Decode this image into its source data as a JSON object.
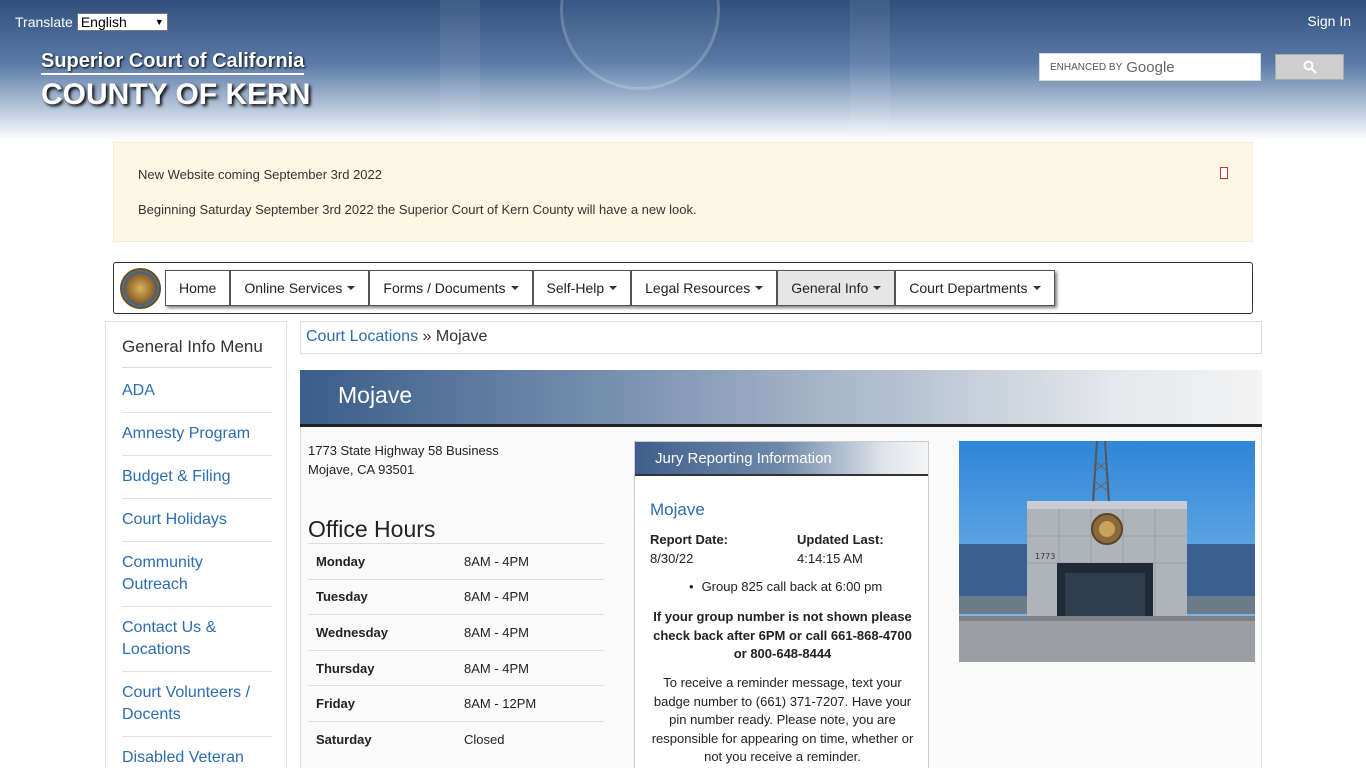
{
  "header": {
    "translate_label": "Translate",
    "language": "English",
    "sign_in": "Sign In",
    "brand_line1": "Superior Court of California",
    "brand_line2": "COUNTY OF KERN",
    "search_placeholder": "ENHANCED BY",
    "search_brand": "Google"
  },
  "alert": {
    "title": "New Website coming September 3rd 2022",
    "body": "Beginning Saturday September 3rd 2022 the Superior Court of Kern County will have a new look."
  },
  "nav": {
    "items": [
      {
        "label": "Home",
        "caret": false
      },
      {
        "label": "Online Services",
        "caret": true
      },
      {
        "label": "Forms / Documents",
        "caret": true
      },
      {
        "label": "Self-Help",
        "caret": true
      },
      {
        "label": "Legal Resources",
        "caret": true
      },
      {
        "label": "General Info",
        "caret": true
      },
      {
        "label": "Court Departments",
        "caret": true
      }
    ]
  },
  "sidebar": {
    "title": "General Info Menu",
    "items": [
      "ADA",
      "Amnesty Program",
      "Budget & Filing",
      "Court Holidays",
      "Community Outreach",
      "Contact Us & Locations",
      "Court Volunteers / Docents",
      "Disabled Veteran Business Enterprise"
    ]
  },
  "breadcrumb": {
    "parent": "Court Locations",
    "sep": "»",
    "current": "Mojave"
  },
  "page": {
    "title": "Mojave",
    "address_line1": "1773 State Highway 58 Business",
    "address_line2": "Mojave, CA 93501",
    "office_hours_title": "Office Hours",
    "hours": [
      {
        "day": "Monday",
        "time": "8AM - 4PM"
      },
      {
        "day": "Tuesday",
        "time": "8AM - 4PM"
      },
      {
        "day": "Wednesday",
        "time": "8AM - 4PM"
      },
      {
        "day": "Thursday",
        "time": "8AM - 4PM"
      },
      {
        "day": "Friday",
        "time": "8AM - 12PM"
      },
      {
        "day": "Saturday",
        "time": "Closed"
      }
    ]
  },
  "jury": {
    "heading": "Jury Reporting Information",
    "location": "Mojave",
    "report_date_label": "Report Date:",
    "report_date": "8/30/22",
    "updated_label": "Updated Last:",
    "updated": "4:14:15 AM",
    "group_note": "Group 825 call back at 6:00 pm",
    "warning": "If your group number is not shown please check back after 6PM or call 661-868-4700 or 800-648-8444",
    "reminder": "To receive a reminder message, text your badge number to (661) 371-7207. Have your pin number ready. Please note, you are responsible for appearing on time, whether or not you receive a reminder."
  },
  "photo": {
    "building_number": "1773"
  }
}
